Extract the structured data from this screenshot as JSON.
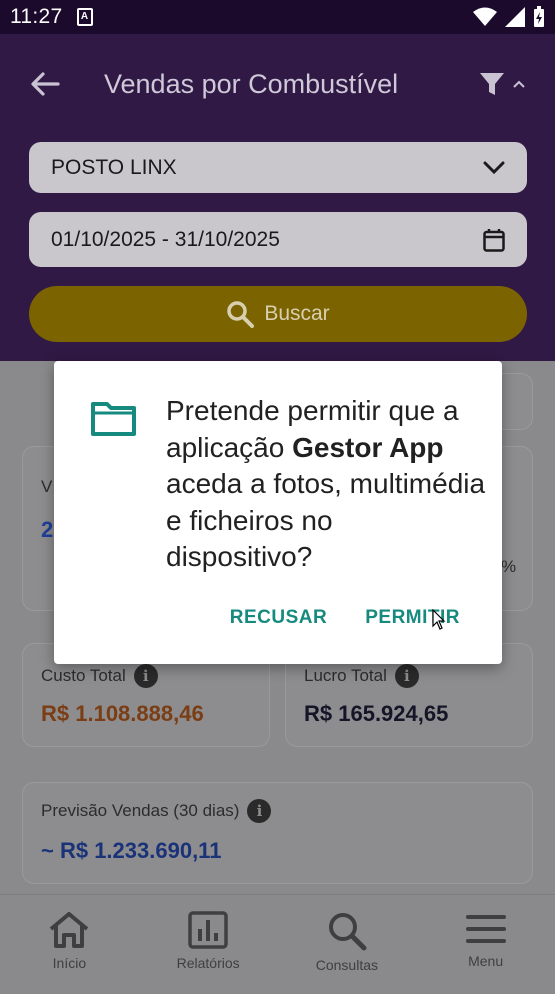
{
  "status_bar": {
    "time": "11:27"
  },
  "header": {
    "title": "Vendas por Combustível",
    "station_select": "POSTO LINX",
    "date_range": "01/10/2025 - 31/10/2025",
    "search_label": "Buscar"
  },
  "background_cards": {
    "partial_left_label": "V",
    "partial_left_value": "2",
    "partial_right_pct": "%",
    "custo_total": {
      "label": "Custo Total",
      "value": "R$ 1.108.888,46"
    },
    "lucro_total": {
      "label": "Lucro Total",
      "value": "R$ 165.924,65"
    },
    "previsao": {
      "label": "Previsão Vendas (30 dias)",
      "value": "~ R$ 1.233.690,11"
    }
  },
  "bottom_nav": [
    {
      "label": "Início",
      "icon": "home-icon"
    },
    {
      "label": "Relatórios",
      "icon": "bar-chart-icon"
    },
    {
      "label": "Consultas",
      "icon": "search-icon"
    },
    {
      "label": "Menu",
      "icon": "menu-icon"
    }
  ],
  "dialog": {
    "msg_before": "Pretende permitir que a aplicação ",
    "app_name": "Gestor App",
    "msg_after": " aceda a fotos, multimédia e ficheiros no dispositivo?",
    "deny_label": "RECUSAR",
    "allow_label": "PERMITIR"
  },
  "colors": {
    "header_bg": "#301944",
    "accent_button": "#f2c200",
    "dialog_button": "#168a7e",
    "custo_value": "#b4541c",
    "lucro_value": "#1c1c3a",
    "previsao_value": "#1f3f9a"
  }
}
